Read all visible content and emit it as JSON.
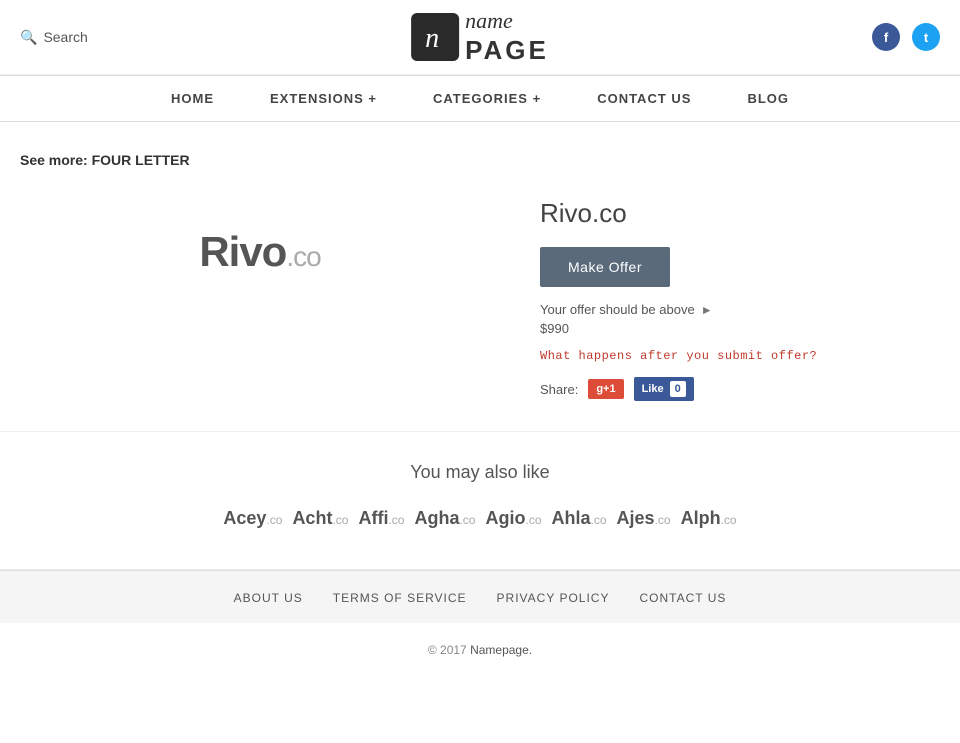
{
  "header": {
    "search_label": "Search",
    "logo_icon_char": "n",
    "logo_name_line": "name",
    "logo_page_line": "PAGE",
    "facebook_label": "f",
    "twitter_label": "t"
  },
  "nav": {
    "items": [
      {
        "label": "HOME",
        "href": "#"
      },
      {
        "label": "EXTENSIONS +",
        "href": "#"
      },
      {
        "label": "CATEGORIES +",
        "href": "#"
      },
      {
        "label": "CONTACT US",
        "href": "#"
      },
      {
        "label": "BLOG",
        "href": "#"
      }
    ]
  },
  "breadcrumb": {
    "prefix": "See more:",
    "link_label": "FOUR LETTER"
  },
  "domain": {
    "name": "Rivo",
    "tld": ".co",
    "full": "Rivo.co",
    "offer_button": "Make Offer",
    "offer_hint": "Your offer should be above",
    "offer_price": "$990",
    "submit_question": "What happens after you submit offer?",
    "share_label": "Share:",
    "gplus_label": "g+1",
    "fb_like_label": "Like",
    "fb_count": "0"
  },
  "also_like": {
    "title": "You may also like",
    "items": [
      {
        "name": "Acey",
        "tld": ".co"
      },
      {
        "name": "Acht",
        "tld": ".co"
      },
      {
        "name": "Affi",
        "tld": ".co"
      },
      {
        "name": "Agha",
        "tld": ".co"
      },
      {
        "name": "Agio",
        "tld": ".co"
      },
      {
        "name": "Ahla",
        "tld": ".co"
      },
      {
        "name": "Ajes",
        "tld": ".co"
      },
      {
        "name": "Alph",
        "tld": ".co"
      }
    ]
  },
  "footer": {
    "links": [
      {
        "label": "ABOUT US",
        "href": "#"
      },
      {
        "label": "TERMS OF SERVICE",
        "href": "#"
      },
      {
        "label": "PRIVACY POLICY",
        "href": "#"
      },
      {
        "label": "CONTACT US",
        "href": "#"
      }
    ],
    "copy_prefix": "© 2017",
    "copy_brand": "Namepage.",
    "copy_suffix": ""
  }
}
